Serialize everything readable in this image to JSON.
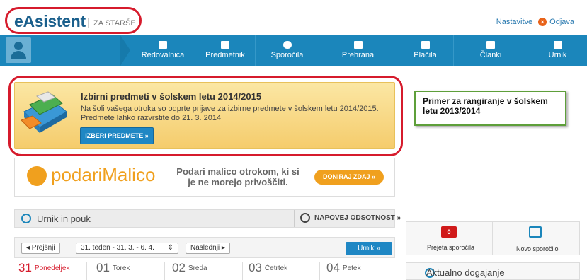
{
  "header": {
    "logo": "eAsistent",
    "logo_sub": "ZA STARŠE",
    "teachers_link": "Nastavitve",
    "logout_link": "Odjava"
  },
  "nav": {
    "items": [
      {
        "label": "Redovalnica",
        "icon": "gradebook-icon"
      },
      {
        "label": "Predmetnik",
        "icon": "plus-square-icon"
      },
      {
        "label": "Sporočila",
        "icon": "chat-icon"
      },
      {
        "label": "Prehrana",
        "icon": "food-icon"
      },
      {
        "label": "Plačila",
        "icon": "wallet-icon"
      },
      {
        "label": "Članki",
        "icon": "plus-square-icon"
      },
      {
        "label": "Urnik",
        "icon": "calendar-icon"
      }
    ]
  },
  "banner": {
    "title": "Izbirni predmeti v šolskem letu 2014/2015",
    "line1": "Na šoli vašega otroka so odprte prijave za izbirne predmete v šolskem letu 2014/2015.",
    "line2": "Predmete lahko razvrstite do 21. 3. 2014",
    "button": "IZBERI PREDMETE »"
  },
  "annotation": "Primer za rangiranje v šolskem letu 2013/2014",
  "malico": {
    "logo": "podariMalico",
    "text1": "Podari malico otrokom, ki si",
    "text2": "je ne morejo privoščiti.",
    "button": "DONIRAJ ZDAJ »"
  },
  "urnik": {
    "title": "Urnik in pouk",
    "absence": "NAPOVEJ ODSOTNOST »",
    "prev": "◂ Prejšnji",
    "week": "31. teden - 31. 3. - 6. 4.",
    "next": "Naslednji ▸",
    "urnik_btn": "Urnik »",
    "days": [
      {
        "num": "31",
        "name": "Ponedeljek"
      },
      {
        "num": "01",
        "name": "Torek"
      },
      {
        "num": "02",
        "name": "Sreda"
      },
      {
        "num": "03",
        "name": "Četrtek"
      },
      {
        "num": "04",
        "name": "Petek"
      }
    ]
  },
  "side": {
    "messages_count": "0",
    "messages_label": "Prejeta sporočila",
    "new_message_label": "Novo sporočilo",
    "news_title": "Aktualno dogajanje"
  },
  "colors": {
    "nav_blue": "#1b86bb",
    "highlight_red": "#d61b2c",
    "banner_yellow": "#f5cc6c",
    "malico_orange": "#f0a01e"
  }
}
